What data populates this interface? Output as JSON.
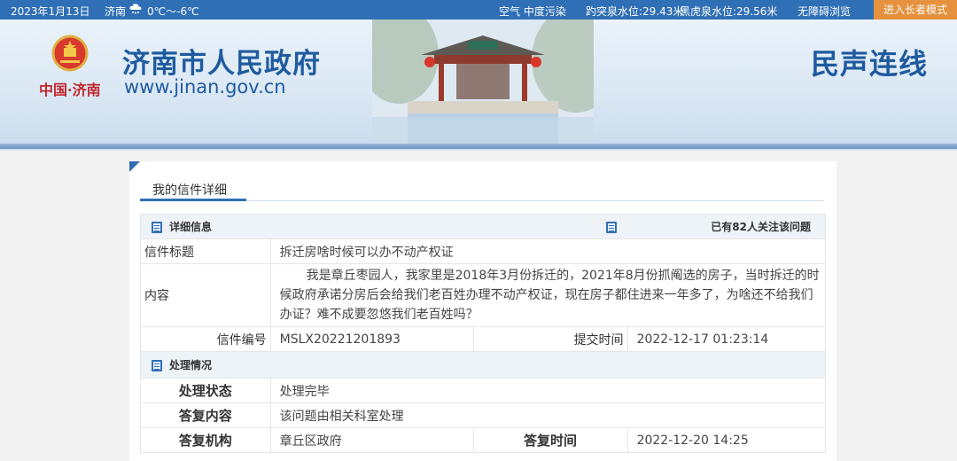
{
  "topbar": {
    "date": "2023年1月13日",
    "city": "济南",
    "weather_icon": "cloud-snow-icon",
    "temperature": "0℃～-6℃",
    "air_quality": "空气 中度污染",
    "baotu_spring": "趵突泉水位:29.43米",
    "heihu_spring": "黑虎泉水位:29.56米",
    "accessibility": "无障碍浏览",
    "elder_mode": "进入长者模式"
  },
  "header": {
    "site_title": "济南市人民政府",
    "site_url": "www.jinan.gov.cn",
    "logo_text": "中国·济南",
    "section_name": "民声连线"
  },
  "panel": {
    "tab_label": "我的信件详细",
    "detail_section": {
      "heading": "详细信息",
      "follow_count": "已有82人关注该问题",
      "rows": {
        "title_label": "信件标题",
        "title_value": "拆迁房啥时候可以办不动产权证",
        "content_label": "内容",
        "content_value": "我是章丘枣园人，我家里是2018年3月份拆迁的，2021年8月份抓阄选的房子，当时拆迁的时候政府承诺分房后会给我们老百姓办理不动产权证，现在房子都住进来一年多了，为啥还不给我们办证？难不成要忽悠我们老百姓吗？",
        "number_label": "信件编号",
        "number_value": "MSLX20221201893",
        "submit_label": "提交时间",
        "submit_value": "2022-12-17 01:23:14"
      }
    },
    "handling_section": {
      "heading": "处理情况",
      "rows": {
        "status_label": "处理状态",
        "status_value": "处理完毕",
        "reply_content_label": "答复内容",
        "reply_content_value": "该问题由相关科室处理",
        "reply_org_label": "答复机构",
        "reply_org_value": "章丘区政府",
        "reply_time_label": "答复时间",
        "reply_time_value": "2022-12-20 14:25"
      }
    }
  },
  "colors": {
    "brand_blue": "#2f6fb5",
    "title_blue": "#1f5b9f",
    "elder_orange": "#e6913d",
    "emblem_red": "#c0252b"
  }
}
